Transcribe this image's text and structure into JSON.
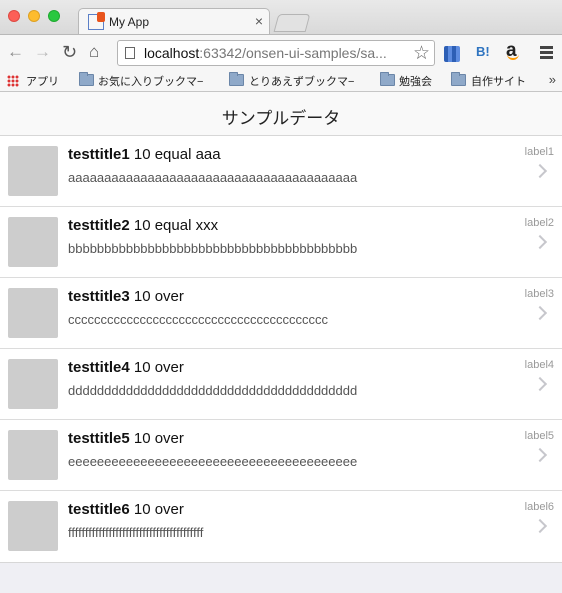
{
  "browser": {
    "tab_title": "My App",
    "tab_close": "×",
    "url_host": "localhost",
    "url_rest": ":63342/onsen-ui-samples/sa...",
    "bookmarks": [
      {
        "label": "アプリ"
      },
      {
        "label": "お気に入りブックマ−"
      },
      {
        "label": "とりあえずブックマ−"
      },
      {
        "label": "勉強会"
      },
      {
        "label": "自作サイト"
      }
    ],
    "bookmarks_more": "»",
    "hatena_label": "B!",
    "amazon_label": "a"
  },
  "app": {
    "title": "サンプルデータ",
    "items": [
      {
        "title_bold": "testtitle1",
        "title_rest": " 10 equal aaa",
        "desc": "aaaaaaaaaaaaaaaaaaaaaaaaaaaaaaaaaaaaaaaa",
        "label": "label1"
      },
      {
        "title_bold": "testtitle2",
        "title_rest": " 10 equal xxx",
        "desc": "bbbbbbbbbbbbbbbbbbbbbbbbbbbbbbbbbbbbbbbb",
        "label": "label2"
      },
      {
        "title_bold": "testtitle3",
        "title_rest": " 10 over",
        "desc": "cccccccccccccccccccccccccccccccccccccccc",
        "label": "label3"
      },
      {
        "title_bold": "testtitle4",
        "title_rest": " 10 over",
        "desc": "dddddddddddddddddddddddddddddddddddddddd",
        "label": "label4"
      },
      {
        "title_bold": "testtitle5",
        "title_rest": " 10 over",
        "desc": "eeeeeeeeeeeeeeeeeeeeeeeeeeeeeeeeeeeeeeee",
        "label": "label5"
      },
      {
        "title_bold": "testtitle6",
        "title_rest": " 10 over",
        "desc": "ffffffffffffffffffffffffffffffffffffffff",
        "label": "label6"
      }
    ]
  }
}
